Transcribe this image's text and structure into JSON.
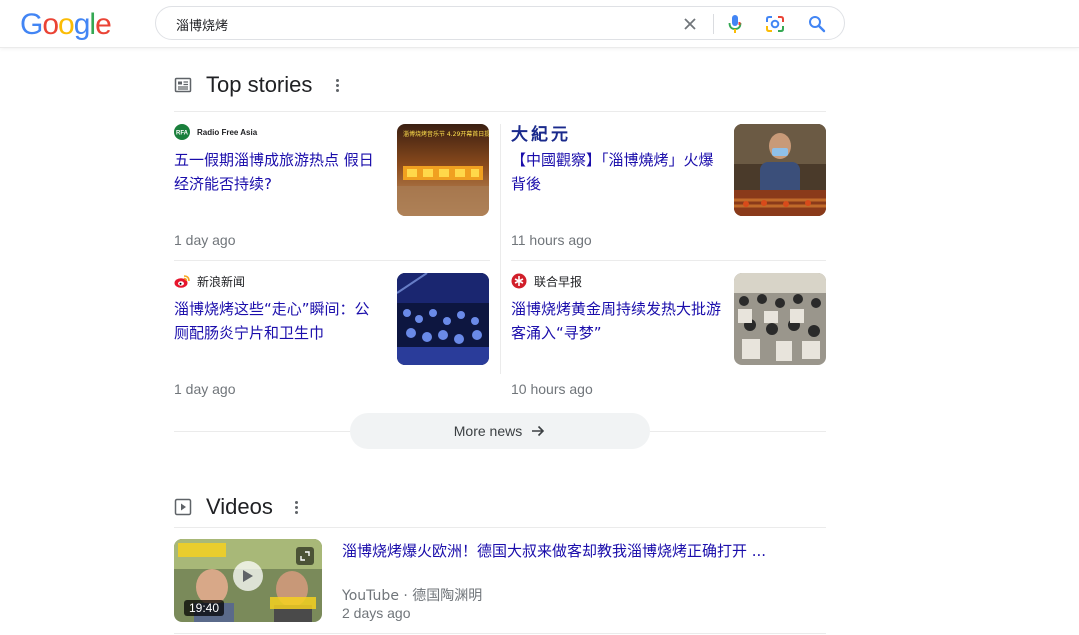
{
  "header": {
    "logo": [
      "G",
      "o",
      "o",
      "g",
      "l",
      "e"
    ],
    "logo_colors": [
      "#4285f4",
      "#ea4335",
      "#fbbc05",
      "#4285f4",
      "#34a853",
      "#ea4335"
    ],
    "search_value": "淄博烧烤",
    "clear_icon": "close-icon",
    "mic_icon": "mic-icon",
    "lens_icon": "camera-icon",
    "search_icon": "search-icon"
  },
  "top_stories": {
    "title": "Top stories",
    "items": [
      {
        "source": "Radio Free Asia",
        "source_logo_text": "RFA",
        "headline": "五一假期淄博成旅游热点 假日经济能否持续?",
        "thumb_caption": "淄博烧烤音乐节 4.29开幕首日提况",
        "time": "1 day ago"
      },
      {
        "source": "大紀元",
        "headline": "【中國觀察】「淄博燒烤」火爆背後",
        "time": "11 hours ago"
      },
      {
        "source": "新浪新闻",
        "headline": "淄博烧烤这些“走心”瞬间：公厕配肠炎宁片和卫生巾",
        "time": "1 day ago"
      },
      {
        "source": "联合早报",
        "headline": "淄博烧烤黄金周持续发热大批游客涌入“寻梦”",
        "time": "10 hours ago"
      }
    ],
    "more_label": "More news"
  },
  "videos": {
    "title": "Videos",
    "items": [
      {
        "title": "淄博烧烤爆火欧洲！德国大叔来做客却教我淄博烧烤正确打开 ...",
        "source": "YouTube · 德国陶渊明",
        "date": "2 days ago",
        "duration": "19:40"
      }
    ]
  },
  "colors": {
    "link": "#1a0dab",
    "muted": "#70757a",
    "divider": "#ebebeb"
  }
}
